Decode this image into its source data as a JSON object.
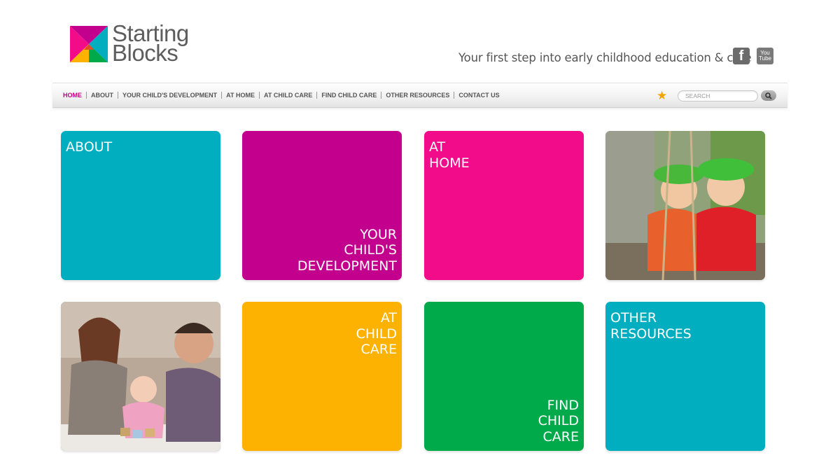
{
  "brand": {
    "line1": "Starting",
    "line2": "Blocks"
  },
  "tagline": "Your first step into early childhood education & care",
  "social": {
    "facebook": "f",
    "youtube_line1": "You",
    "youtube_line2": "Tube"
  },
  "nav": {
    "items": [
      "HOME",
      "ABOUT",
      "YOUR CHILD'S DEVELOPMENT",
      "AT HOME",
      "AT CHILD CARE",
      "FIND CHILD CARE",
      "OTHER RESOURCES",
      "CONTACT US"
    ],
    "search_placeholder": "SEARCH"
  },
  "tiles": {
    "about": "ABOUT",
    "development": "YOUR\nCHILD'S\nDEVELOPMENT",
    "at_home": "AT\nHOME",
    "at_child_care": "AT\nCHILD\nCARE",
    "find_child_care": "FIND\nCHILD\nCARE",
    "other_resources": "OTHER\nRESOURCES"
  },
  "colors": {
    "teal": "#00aec0",
    "purple": "#c2008d",
    "pink": "#f20c8a",
    "orange": "#fdb100",
    "green": "#00a94a",
    "nav_active": "#c3008a",
    "star": "#f0a500"
  },
  "icons": [
    "starting-blocks-logo-icon",
    "facebook-icon",
    "youtube-icon",
    "star-icon",
    "search-icon"
  ]
}
